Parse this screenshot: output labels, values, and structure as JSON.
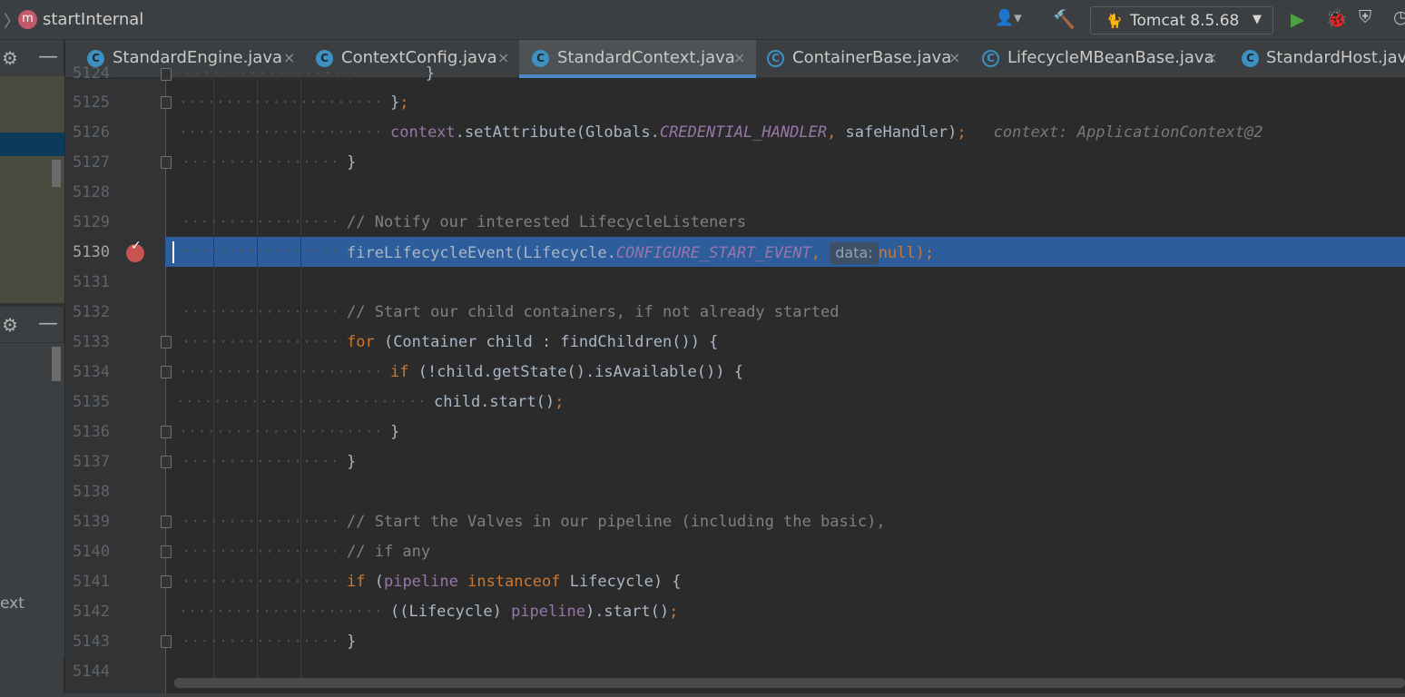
{
  "breadcrumb": {
    "method_badge": "m",
    "method_name": "startInternal"
  },
  "toolbar": {
    "user_icon": "👤▾",
    "build_icon": "🔨",
    "run_config_label": "Tomcat 8.5.68",
    "run_config_icon": "🐈",
    "dropdown_arrow": "▼",
    "run_icon": "▶",
    "debug_icon": "🐞",
    "coverage_icon": "⛨",
    "more_icon": "◷"
  },
  "left_panel": {
    "gear": "⚙",
    "minimize": "—",
    "truncated_text": "ext"
  },
  "tabs": [
    {
      "label": "StandardEngine.java",
      "icon": "C",
      "abstract": false,
      "active": false
    },
    {
      "label": "ContextConfig.java",
      "icon": "C",
      "abstract": false,
      "active": false
    },
    {
      "label": "StandardContext.java",
      "icon": "C",
      "abstract": false,
      "active": true
    },
    {
      "label": "ContainerBase.java",
      "icon": "C",
      "abstract": true,
      "active": false
    },
    {
      "label": "LifecycleMBeanBase.java",
      "icon": "C",
      "abstract": true,
      "active": false
    },
    {
      "label": "StandardHost.java",
      "icon": "C",
      "abstract": false,
      "active": false
    }
  ],
  "tab_close": "×",
  "editor": {
    "line_numbers": [
      "5124",
      "5125",
      "5126",
      "5127",
      "5128",
      "5129",
      "5130",
      "5131",
      "5132",
      "5133",
      "5134",
      "5135",
      "5136",
      "5137",
      "5138",
      "5139",
      "5140",
      "5141",
      "5142",
      "5143",
      "5144"
    ],
    "current_line": "5130",
    "breakpoint_check": "✓",
    "code": {
      "l5124": "}",
      "l5125_brace": "}",
      "l5125_semi": ";",
      "l5126_a": "context",
      "l5126_b": ".setAttribute(Globals.",
      "l5126_c": "CREDENTIAL_HANDLER",
      "l5126_d": ",",
      "l5126_e": " safeHandler)",
      "l5126_f": ";",
      "l5126_hint": "context: ApplicationContext@2",
      "l5127": "}",
      "l5129": "// Notify our interested LifecycleListeners",
      "l5130_a": "fireLifecycleEvent(Lifecycle.",
      "l5130_b": "CONFIGURE_START_EVENT",
      "l5130_c": ",",
      "l5130_hint": "data:",
      "l5130_d": "null",
      "l5130_e": ");",
      "l5132": "// Start our child containers, if not already started",
      "l5133_a": "for",
      "l5133_b": " (Container child : findChildren()) {",
      "l5134_a": "if",
      "l5134_b": " (!child.getState().isAvailable()) {",
      "l5135_a": "child.start()",
      "l5135_b": ";",
      "l5136": "}",
      "l5137": "}",
      "l5139": "// Start the Valves in our pipeline (including the basic),",
      "l5140": "// if any",
      "l5141_a": "if",
      "l5141_b": " (",
      "l5141_c": "pipeline",
      "l5141_d": "instanceof",
      "l5141_e": " Lifecycle) {",
      "l5142_a": "((Lifecycle) ",
      "l5142_b": "pipeline",
      "l5142_c": ").start()",
      "l5142_d": ";",
      "l5143": "}"
    }
  }
}
